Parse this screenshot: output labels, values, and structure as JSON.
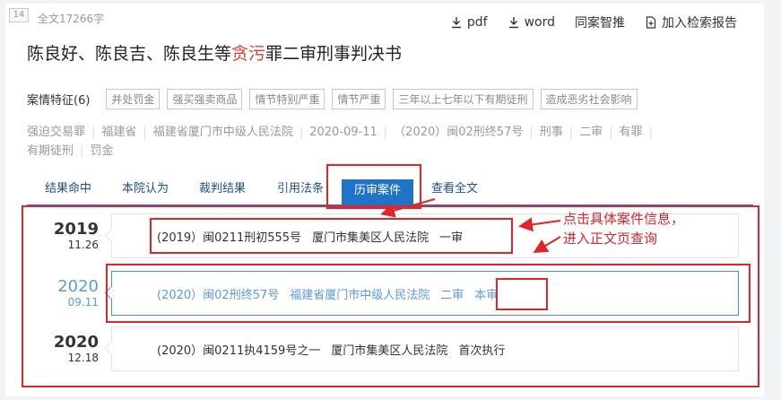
{
  "badge": "14",
  "fulltext": "全文17266字",
  "toolbar": {
    "pdf": "pdf",
    "word": "word",
    "similar": "同案智推",
    "report": "加入检索报告"
  },
  "title": {
    "before": "陈良好、陈良吉、陈良生等",
    "highlight": "贪污",
    "after": "罪二审刑事判决书"
  },
  "features": {
    "label": "案情特征(6)",
    "tags": [
      "并处罚金",
      "强买强卖商品",
      "情节特别严重",
      "情节严重",
      "三年以上七年以下有期徒刑",
      "造成恶劣社会影响"
    ]
  },
  "meta": {
    "items": [
      "强迫交易罪",
      "福建省",
      "福建省厦门市中级人民法院",
      "2020-09-11",
      "（2020）闽02刑终57号",
      "刑事",
      "二审",
      "有罪",
      "有期徒刑",
      "罚金"
    ]
  },
  "tabs": [
    "结果命中",
    "本院认为",
    "裁判结果",
    "引用法条",
    "历审案件",
    "查看全文"
  ],
  "timeline": [
    {
      "year": "2019",
      "day": "11.26",
      "case_no": "(2019）闽0211刑初555号",
      "court": "厦门市集美区人民法院",
      "stage": "一审",
      "tag": ""
    },
    {
      "year": "2020",
      "day": "09.11",
      "case_no": "(2020）闽02刑终57号",
      "court": "福建省厦门市中级人民法院",
      "stage": "二审",
      "tag": "本审"
    },
    {
      "year": "2020",
      "day": "12.18",
      "case_no": "(2020）闽0211执4159号之一",
      "court": "厦门市集美区人民法院",
      "stage": "首次执行",
      "tag": ""
    }
  ],
  "annotation": {
    "line1": "点击具体案件信息，",
    "line2": "进入正文页查询"
  },
  "colors": {
    "accent": "#1f73c8",
    "annotation_red": "#e0252b",
    "highlight": "#e03c31",
    "current": "#5b9be0"
  }
}
